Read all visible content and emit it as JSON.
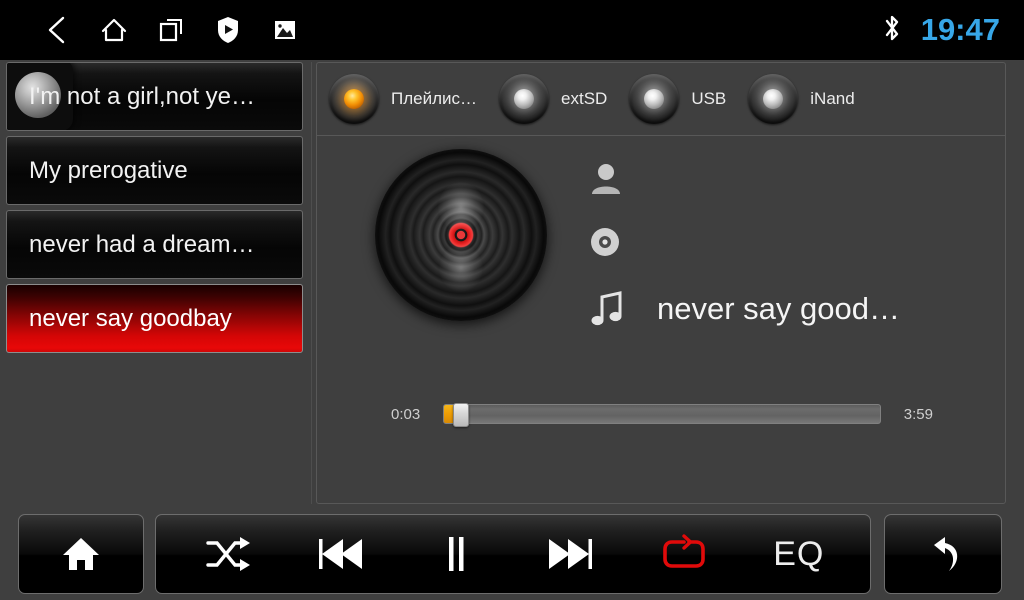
{
  "statusbar": {
    "icons": [
      {
        "name": "back-icon",
        "label": "back"
      },
      {
        "name": "home-icon",
        "label": "home"
      },
      {
        "name": "recent-apps-icon",
        "label": "recent apps"
      },
      {
        "name": "shield-play-icon",
        "label": "shield"
      },
      {
        "name": "gallery-icon",
        "label": "gallery"
      }
    ],
    "bluetooth_icon": "bluetooth-icon",
    "time": "19:47",
    "time_color": "#37a7e8"
  },
  "playlist": {
    "items": [
      {
        "title": "I'm not a girl,not ye…",
        "selected": false,
        "ripple": true
      },
      {
        "title": "My prerogative",
        "selected": false,
        "ripple": false
      },
      {
        "title": "never had a dream…",
        "selected": false,
        "ripple": false
      },
      {
        "title": "never say goodbay",
        "selected": true,
        "ripple": false
      }
    ],
    "selected_color": "#d40606"
  },
  "sources": {
    "items": [
      {
        "label": "Плейлис…",
        "selected": true
      },
      {
        "label": "extSD",
        "selected": false
      },
      {
        "label": "USB",
        "selected": false
      },
      {
        "label": "iNand",
        "selected": false
      }
    ],
    "selected_color": "#f38f05"
  },
  "now_playing": {
    "album_art_icon": "vinyl-disc-icon",
    "artist_icon": "person-icon",
    "artist": "",
    "album_icon": "cd-icon",
    "album": "",
    "track_icon": "music-note-icon",
    "track": "never say good…",
    "elapsed": "0:03",
    "duration": "3:59",
    "progress_percent": 1.3
  },
  "bottom_bar": {
    "home_icon": "home-filled-icon",
    "transport": [
      {
        "name": "shuffle-icon",
        "label": "shuffle",
        "active": false
      },
      {
        "name": "previous-icon",
        "label": "previous",
        "active": false
      },
      {
        "name": "pause-icon",
        "label": "pause",
        "active": false
      },
      {
        "name": "next-icon",
        "label": "next",
        "active": false
      },
      {
        "name": "repeat-icon",
        "label": "repeat",
        "active": true
      },
      {
        "name": "eq-button",
        "label": "EQ",
        "active": false
      }
    ],
    "repeat_color": "#e00a0a",
    "back_icon": "return-arrow-icon"
  }
}
